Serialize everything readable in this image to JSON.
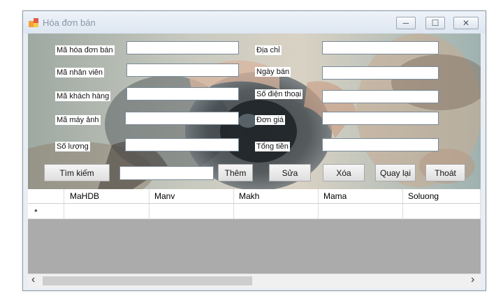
{
  "window": {
    "title": "Hóa đơn bán",
    "controls": {
      "minimize": "─",
      "maximize": "☐",
      "close": "✕"
    }
  },
  "form": {
    "left_fields": [
      {
        "label": "Mã hóa đơn bán",
        "value": ""
      },
      {
        "label": "Mã nhân viên",
        "value": ""
      },
      {
        "label": "Mã khách hàng",
        "value": ""
      },
      {
        "label": "Mã máy ảnh",
        "value": ""
      },
      {
        "label": "Số lượng",
        "value": ""
      }
    ],
    "right_fields": [
      {
        "label": "Địa chỉ",
        "value": ""
      },
      {
        "label": "Ngày bán",
        "value": ""
      },
      {
        "label": "Số điện thoại",
        "value": ""
      },
      {
        "label": "Đơn giá",
        "value": ""
      },
      {
        "label": "Tổng tiền",
        "value": ""
      }
    ]
  },
  "toolbar": {
    "search_label": "Tìm kiếm",
    "search_value": "",
    "add_label": "Thêm",
    "edit_label": "Sửa",
    "delete_label": "Xóa",
    "back_label": "Quay lại",
    "exit_label": "Thoát"
  },
  "grid": {
    "columns": [
      "MaHDB",
      "Manv",
      "Makh",
      "Mama",
      "Soluong"
    ],
    "new_row_marker": "*",
    "scroll_left": "‹",
    "scroll_right": "›"
  },
  "colors": {
    "grid_background": "#ababab",
    "window_title": "#8a97a6"
  }
}
